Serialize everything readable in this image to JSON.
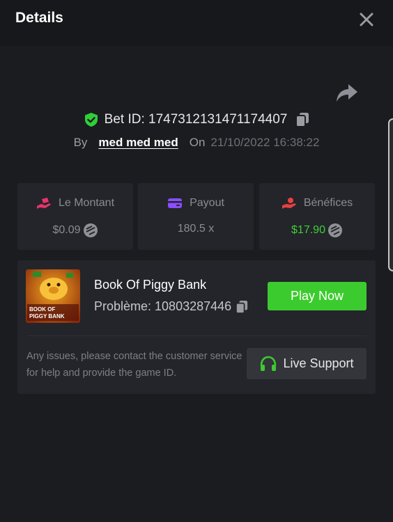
{
  "header": {
    "title": "Details"
  },
  "bet": {
    "id_text": "Bet ID: 1747312131471174407",
    "by_label": "By",
    "user": "med med med",
    "on_label": "On",
    "date": "21/10/2022 16:38:22"
  },
  "stats": [
    {
      "label": "Le Montant",
      "value": "$0.09",
      "icon": "money-hand-icon",
      "color": "#e8336b"
    },
    {
      "label": "Payout",
      "value": "180.5 x",
      "icon": "card-icon",
      "color": "#8b4dff"
    },
    {
      "label": "Bénéfices",
      "value": "$17.90",
      "icon": "profit-hand-icon",
      "color": "#e84040"
    }
  ],
  "game": {
    "title": "Book Of Piggy Bank",
    "id_text": "Problème: 10803287446",
    "play_label": "Play Now",
    "thumb_text_1": "BOOK OF",
    "thumb_text_2": "PIGGY BANK"
  },
  "support": {
    "text": "Any issues, please contact the customer service for help and provide the game ID.",
    "button_label": "Live Support"
  },
  "colors": {
    "accent_green": "#3ccb2e",
    "shield_green": "#2fcf3a",
    "background": "#1b1c20",
    "card": "#23252a"
  }
}
